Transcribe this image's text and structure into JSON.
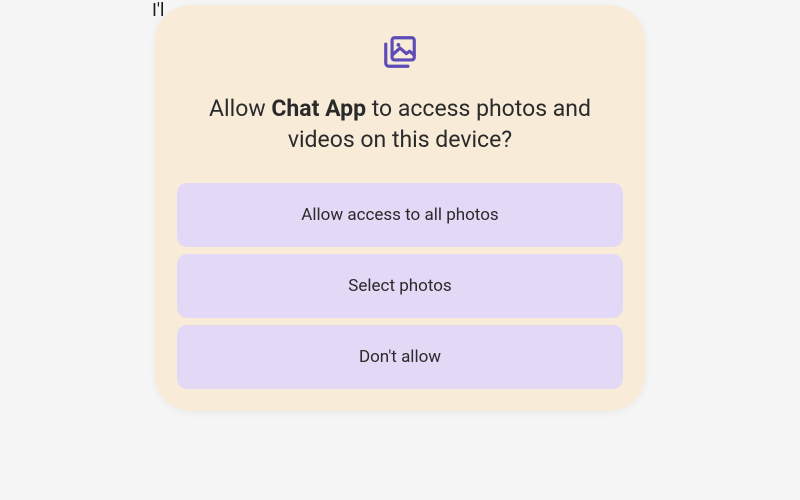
{
  "backdrop": {
    "partial_text": "I'l"
  },
  "dialog": {
    "icon": "photos-stack-icon",
    "icon_color": "#5e4bb8",
    "title_prefix": "Allow ",
    "app_name": "Chat App",
    "title_suffix": " to access photos and videos on this device?",
    "buttons": {
      "allow_all": "Allow access to all photos",
      "select": "Select photos",
      "deny": "Don't allow"
    }
  }
}
